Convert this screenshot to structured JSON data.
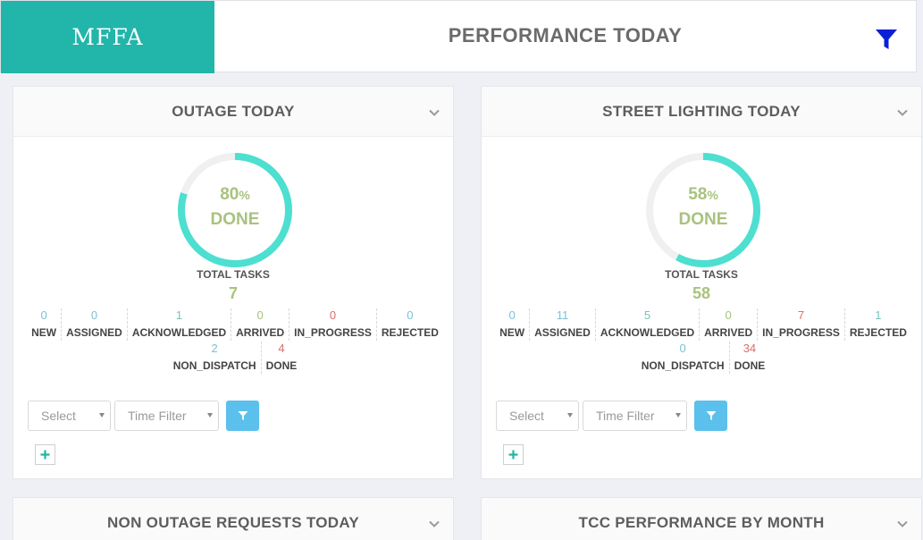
{
  "header": {
    "brand": "MFFA",
    "title": "PERFORMANCE TODAY"
  },
  "colors": {
    "brand": "#22b5a9",
    "ring": "#4ddfd0",
    "ring_track": "#f0f0f0",
    "done_text": "#a9c27f",
    "filter_button": "#5bc0eb",
    "top_filter_icon": "#0a1fd6"
  },
  "cards": [
    {
      "title": "OUTAGE TODAY",
      "percent": "80",
      "percent_sign": "%",
      "done_label": "DONE",
      "percent_value": 0.8,
      "total_label": "TOTAL TASKS",
      "total_value": "7",
      "stats_row1": [
        {
          "value": "0",
          "label": "NEW",
          "color": "#7ac3d6"
        },
        {
          "value": "0",
          "label": "ASSIGNED",
          "color": "#7ac3d6"
        },
        {
          "value": "1",
          "label": "ACKNOWLEDGED",
          "color": "#76c2b8"
        },
        {
          "value": "0",
          "label": "ARRIVED",
          "color": "#a9c27f"
        },
        {
          "value": "0",
          "label": "IN_PROGRESS",
          "color": "#d9706e"
        },
        {
          "value": "0",
          "label": "REJECTED",
          "color": "#7ac3d6"
        }
      ],
      "stats_row2": [
        {
          "value": "2",
          "label": "NON_DISPATCH",
          "color": "#7ac3d6"
        },
        {
          "value": "4",
          "label": "DONE",
          "color": "#d9706e"
        }
      ],
      "select_label": "Select",
      "time_filter_label": "Time Filter"
    },
    {
      "title": "STREET LIGHTING TODAY",
      "percent": "58",
      "percent_sign": "%",
      "done_label": "DONE",
      "percent_value": 0.58,
      "total_label": "TOTAL TASKS",
      "total_value": "58",
      "stats_row1": [
        {
          "value": "0",
          "label": "NEW",
          "color": "#7ac3d6"
        },
        {
          "value": "11",
          "label": "ASSIGNED",
          "color": "#7ac3d6"
        },
        {
          "value": "5",
          "label": "ACKNOWLEDGED",
          "color": "#76c2b8"
        },
        {
          "value": "0",
          "label": "ARRIVED",
          "color": "#a9c27f"
        },
        {
          "value": "7",
          "label": "IN_PROGRESS",
          "color": "#d9706e"
        },
        {
          "value": "1",
          "label": "REJECTED",
          "color": "#76c2b8"
        }
      ],
      "stats_row2": [
        {
          "value": "0",
          "label": "NON_DISPATCH",
          "color": "#7ac3d6"
        },
        {
          "value": "34",
          "label": "DONE",
          "color": "#d9706e"
        }
      ],
      "select_label": "Select",
      "time_filter_label": "Time Filter"
    },
    {
      "title": "NON OUTAGE REQUESTS TODAY"
    },
    {
      "title": "TCC PERFORMANCE BY MONTH"
    }
  ]
}
